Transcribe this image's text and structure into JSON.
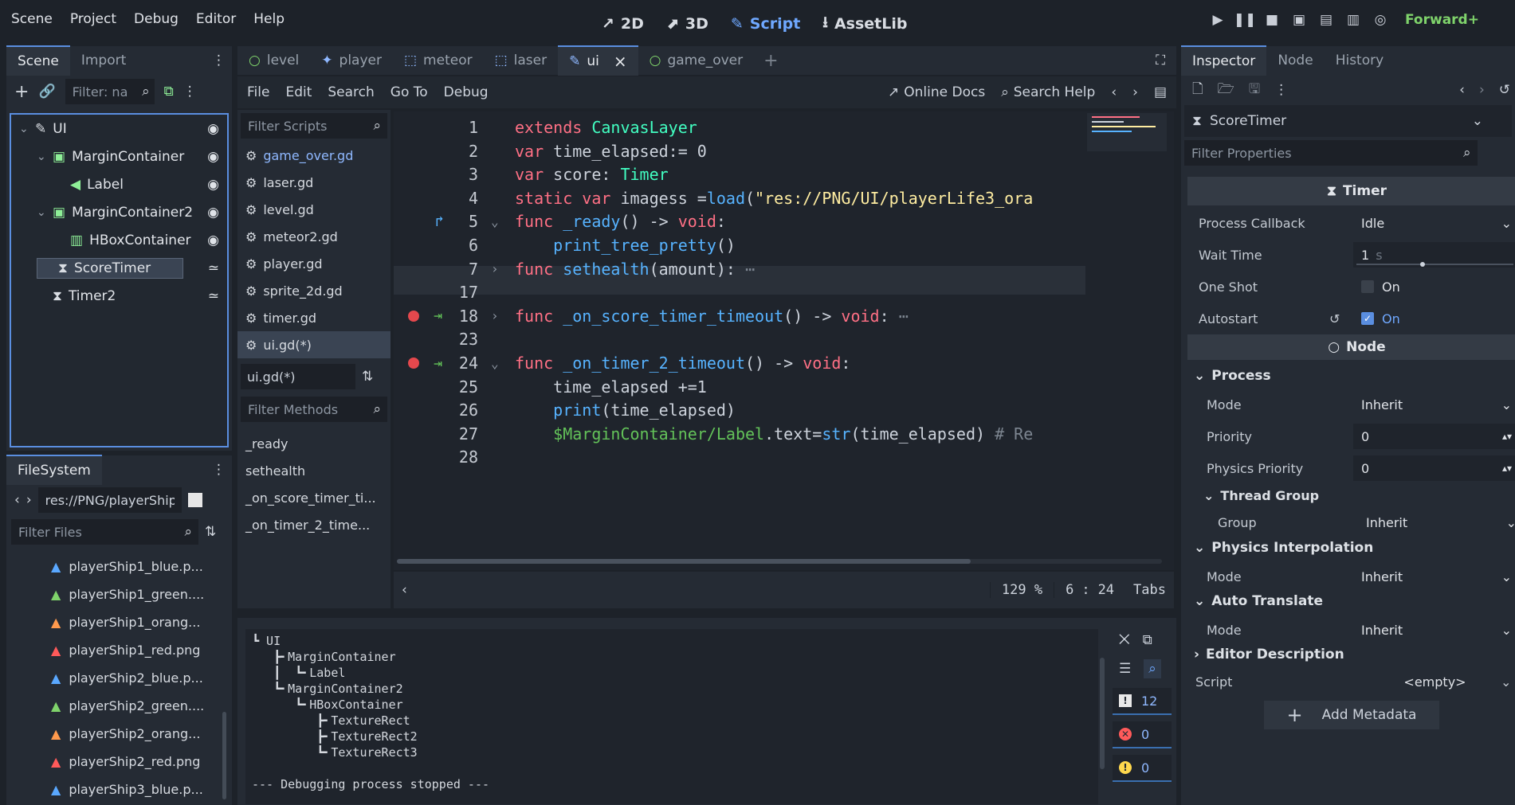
{
  "menubar": {
    "items": [
      "Scene",
      "Project",
      "Debug",
      "Editor",
      "Help"
    ],
    "workspaces": [
      {
        "label": "2D",
        "icon": "2d-icon",
        "active": false
      },
      {
        "label": "3D",
        "icon": "3d-icon",
        "active": false
      },
      {
        "label": "Script",
        "icon": "script-icon",
        "active": true
      },
      {
        "label": "AssetLib",
        "icon": "assetlib-icon",
        "active": false
      }
    ],
    "renderer": "Forward+"
  },
  "scene_dock": {
    "tabs": [
      "Scene",
      "Import"
    ],
    "filter_placeholder": "Filter: na",
    "nodes": [
      {
        "name": "UI",
        "icon": "canvas-layer-icon",
        "depth": 0,
        "color": "#d9dde3",
        "selected": false
      },
      {
        "name": "MarginContainer",
        "icon": "container-icon",
        "depth": 1,
        "color": "#8eef97",
        "selected": false
      },
      {
        "name": "Label",
        "icon": "label-icon",
        "depth": 2,
        "color": "#8eef97",
        "selected": false
      },
      {
        "name": "MarginContainer2",
        "icon": "container-icon",
        "depth": 1,
        "color": "#8eef97",
        "selected": false
      },
      {
        "name": "HBoxContainer",
        "icon": "hbox-icon",
        "depth": 2,
        "color": "#8eef97",
        "selected": false
      },
      {
        "name": "ScoreTimer",
        "icon": "timer-icon",
        "depth": 1,
        "color": "#d9dde3",
        "selected": true
      },
      {
        "name": "Timer2",
        "icon": "timer-icon",
        "depth": 1,
        "color": "#d9dde3",
        "selected": false
      }
    ]
  },
  "filesystem": {
    "tab": "FileSystem",
    "path": "res://PNG/playerShip",
    "filter_placeholder": "Filter Files",
    "files": [
      {
        "name": "playerShip1_blue.p...",
        "color": "#5aa8ff"
      },
      {
        "name": "playerShip1_green....",
        "color": "#7fd36b"
      },
      {
        "name": "playerShip1_orang...",
        "color": "#ff9a4d"
      },
      {
        "name": "playerShip1_red.png",
        "color": "#ff5a5a"
      },
      {
        "name": "playerShip2_blue.p...",
        "color": "#5aa8ff"
      },
      {
        "name": "playerShip2_green....",
        "color": "#7fd36b"
      },
      {
        "name": "playerShip2_orang...",
        "color": "#ff9a4d"
      },
      {
        "name": "playerShip2_red.png",
        "color": "#ff5a5a"
      },
      {
        "name": "playerShip3_blue.p...",
        "color": "#5aa8ff"
      }
    ]
  },
  "script_tabs": [
    {
      "label": "level",
      "icon": "node-icon",
      "active": false
    },
    {
      "label": "player",
      "icon": "character-icon",
      "active": false
    },
    {
      "label": "meteor",
      "icon": "area-icon",
      "active": false
    },
    {
      "label": "laser",
      "icon": "area-icon",
      "active": false
    },
    {
      "label": "ui",
      "icon": "script-edit-icon",
      "active": true
    },
    {
      "label": "game_over",
      "icon": "node-icon",
      "active": false
    }
  ],
  "script_menu": {
    "items": [
      "File",
      "Edit",
      "Search",
      "Go To",
      "Debug"
    ],
    "online_docs": "Online Docs",
    "search_help": "Search Help"
  },
  "scripts_panel": {
    "filter_placeholder": "Filter Scripts",
    "scripts": [
      {
        "name": "game_over.gd",
        "active_link": true,
        "selected": false
      },
      {
        "name": "laser.gd",
        "active_link": false,
        "selected": false
      },
      {
        "name": "level.gd",
        "active_link": false,
        "selected": false
      },
      {
        "name": "meteor2.gd",
        "active_link": false,
        "selected": false
      },
      {
        "name": "player.gd",
        "active_link": false,
        "selected": false
      },
      {
        "name": "sprite_2d.gd",
        "active_link": false,
        "selected": false
      },
      {
        "name": "timer.gd",
        "active_link": false,
        "selected": false
      },
      {
        "name": "ui.gd(*)",
        "active_link": false,
        "selected": true
      }
    ],
    "current": "ui.gd(*)",
    "methods_placeholder": "Filter Methods",
    "methods": [
      "_ready",
      "sethealth",
      "_on_score_timer_ti...",
      "_on_timer_2_time..."
    ]
  },
  "code": {
    "lines": [
      {
        "n": "1",
        "tokens": [
          [
            "kw",
            "extends "
          ],
          [
            "ty",
            "CanvasLayer"
          ]
        ]
      },
      {
        "n": "2",
        "tokens": [
          [
            "kw",
            "var "
          ],
          [
            "tx",
            "time_elapsed:= 0"
          ]
        ]
      },
      {
        "n": "3",
        "tokens": [
          [
            "kw",
            "var "
          ],
          [
            "tx",
            "score: "
          ],
          [
            "ty",
            "Timer"
          ]
        ]
      },
      {
        "n": "4",
        "tokens": [
          [
            "kw",
            "static var "
          ],
          [
            "tx",
            "imagess ="
          ],
          [
            "fn",
            "load"
          ],
          [
            "tx",
            "("
          ],
          [
            "st",
            "\"res://PNG/UI/playerLife3_ora"
          ]
        ]
      },
      {
        "n": "5",
        "tokens": [
          [
            "kw",
            "func "
          ],
          [
            "fn",
            "_ready"
          ],
          [
            "tx",
            "() -> "
          ],
          [
            "kw",
            "void"
          ],
          [
            "tx",
            ":"
          ]
        ],
        "fold": "open",
        "gutter": "override"
      },
      {
        "n": "6",
        "tokens": [
          [
            "tx",
            "    "
          ],
          [
            "fn",
            "print_tree_pretty"
          ],
          [
            "tx",
            "()"
          ]
        ],
        "current": true
      },
      {
        "n": "7",
        "tokens": [
          [
            "kw",
            "func "
          ],
          [
            "fn",
            "sethealth"
          ],
          [
            "tx",
            "(amount):"
          ],
          [
            "cm",
            " ⋯"
          ]
        ],
        "fold": "closed"
      },
      {
        "n": "17",
        "tokens": [
          [
            "tx",
            ""
          ]
        ]
      },
      {
        "n": "18",
        "tokens": [
          [
            "kw",
            "func "
          ],
          [
            "fn",
            "_on_score_timer_timeout"
          ],
          [
            "tx",
            "() -> "
          ],
          [
            "kw",
            "void"
          ],
          [
            "tx",
            ":"
          ],
          [
            "cm",
            " ⋯"
          ]
        ],
        "fold": "closed",
        "gutter": "breakpoint"
      },
      {
        "n": "23",
        "tokens": [
          [
            "tx",
            ""
          ]
        ]
      },
      {
        "n": "24",
        "tokens": [
          [
            "kw",
            "func "
          ],
          [
            "fn",
            "_on_timer_2_timeout"
          ],
          [
            "tx",
            "() -> "
          ],
          [
            "kw",
            "void"
          ],
          [
            "tx",
            ":"
          ]
        ],
        "fold": "open",
        "gutter": "breakpoint"
      },
      {
        "n": "25",
        "tokens": [
          [
            "tx",
            "    time_elapsed +=1"
          ]
        ]
      },
      {
        "n": "26",
        "tokens": [
          [
            "tx",
            "    "
          ],
          [
            "fn",
            "print"
          ],
          [
            "tx",
            "(time_elapsed)"
          ]
        ]
      },
      {
        "n": "27",
        "tokens": [
          [
            "tx",
            "    "
          ],
          [
            "np",
            "$MarginContainer/Label"
          ],
          [
            "tx",
            "."
          ],
          [
            "tx",
            "text"
          ],
          [
            "tx",
            "="
          ],
          [
            "fn",
            "str"
          ],
          [
            "tx",
            "(time_elapsed) "
          ],
          [
            "cm",
            "# Re"
          ]
        ]
      },
      {
        "n": "28",
        "tokens": [
          [
            "tx",
            ""
          ]
        ]
      }
    ],
    "zoom": "129 %",
    "line": "6",
    "column": "24",
    "indent": "Tabs"
  },
  "output": {
    "lines": [
      "┗ UI",
      "   ┣╸MarginContainer",
      "   ┃  ┗╸Label",
      "   ┗╸MarginContainer2",
      "      ┗╸HBoxContainer",
      "         ┣╸TextureRect",
      "         ┣╸TextureRect2",
      "         ┗╸TextureRect3",
      "",
      "--- Debugging process stopped ---"
    ],
    "messages": "12",
    "errors": "0",
    "warnings": "0"
  },
  "inspector": {
    "tabs": [
      "Inspector",
      "Node",
      "History"
    ],
    "object": "ScoreTimer",
    "filter_placeholder": "Filter Properties",
    "timer_section": "Timer",
    "process_callback_label": "Process Callback",
    "process_callback_value": "Idle",
    "wait_time_label": "Wait Time",
    "wait_time_value": "1",
    "wait_time_unit": "s",
    "one_shot_label": "One Shot",
    "one_shot_text": "On",
    "one_shot_checked": false,
    "autostart_label": "Autostart",
    "autostart_text": "On",
    "autostart_checked": true,
    "node_section": "Node",
    "process_group": "Process",
    "mode_label": "Mode",
    "mode_value": "Inherit",
    "priority_label": "Priority",
    "priority_value": "0",
    "physics_priority_label": "Physics Priority",
    "physics_priority_value": "0",
    "thread_group": "Thread Group",
    "group_label": "Group",
    "group_value": "Inherit",
    "physics_interp_group": "Physics Interpolation",
    "physics_interp_mode": "Inherit",
    "auto_translate_group": "Auto Translate",
    "auto_translate_mode": "Inherit",
    "editor_desc_group": "Editor Description",
    "script_label": "Script",
    "script_value": "<empty>",
    "add_metadata": "Add Metadata"
  }
}
